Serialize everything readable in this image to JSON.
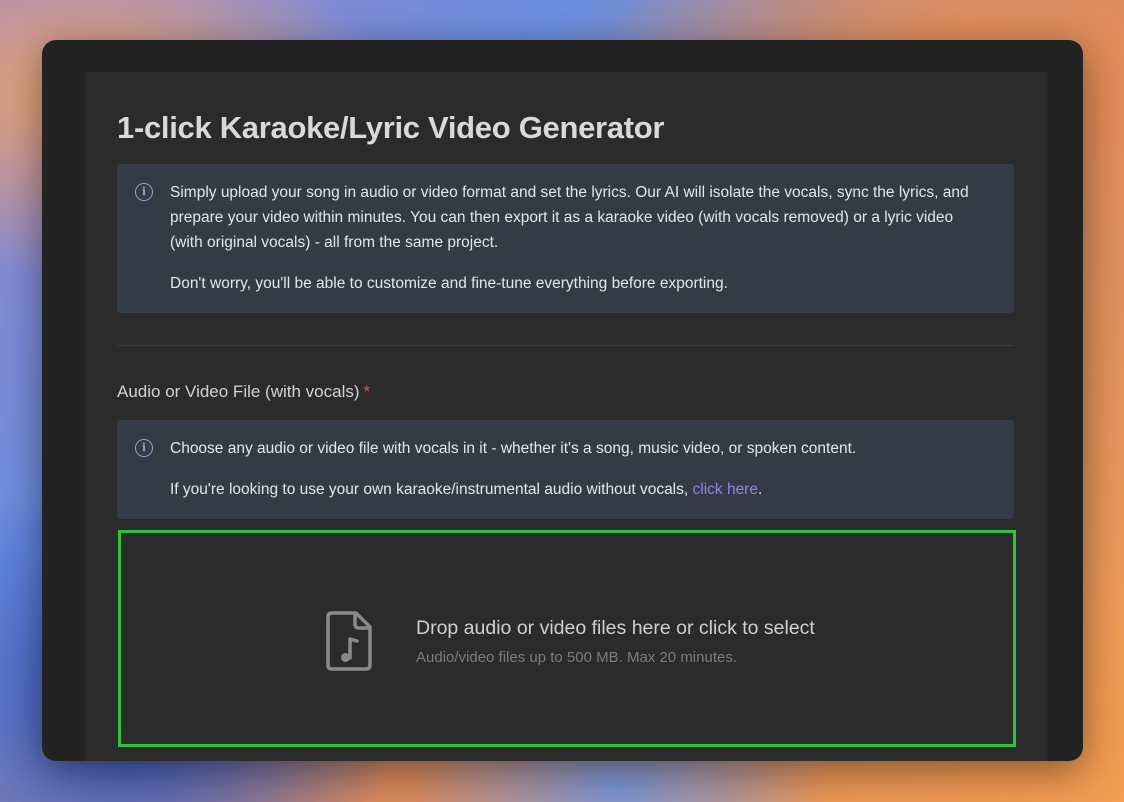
{
  "page": {
    "title": "1-click Karaoke/Lyric Video Generator"
  },
  "intro": {
    "icon": "info-icon",
    "paragraph1": "Simply upload your song in audio or video format and set the lyrics. Our AI will isolate the vocals, sync the lyrics, and prepare your video within minutes. You can then export it as a karaoke video (with vocals removed) or a lyric video (with original vocals) - all from the same project.",
    "paragraph2": "Don't worry, you'll be able to customize and fine-tune everything before exporting."
  },
  "upload_field": {
    "label": "Audio or Video File (with vocals)",
    "required_marker": "*",
    "info": {
      "icon": "info-icon",
      "line1": "Choose any audio or video file with vocals in it - whether it's a song, music video, or spoken content.",
      "line2_prefix": "If you're looking to use your own karaoke/instrumental audio without vocals,",
      "line2_link": "click here",
      "line2_suffix": "."
    },
    "dropzone": {
      "icon": "music-file-icon",
      "primary_text": "Drop audio or video files here or click to select",
      "secondary_text": "Audio/video files up to 500 MB. Max 20 minutes."
    }
  },
  "colors": {
    "accent_link": "#9a7fe6",
    "dropzone_border": "#2fc23a",
    "required": "#e05555",
    "info_bg": "#343a46"
  }
}
